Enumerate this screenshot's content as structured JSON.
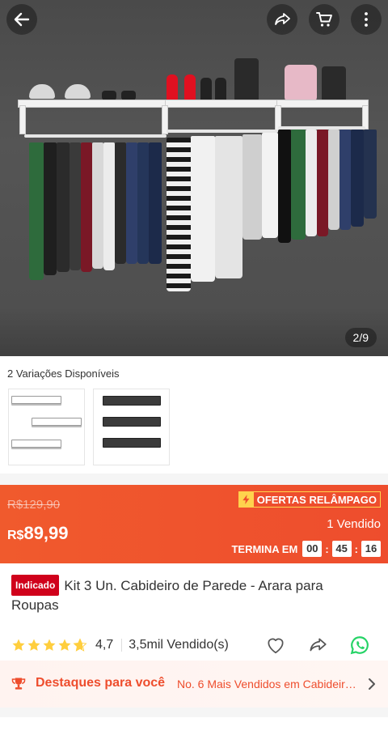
{
  "header": {
    "back_icon": "arrow-left-icon",
    "share_icon": "share-icon",
    "cart_icon": "cart-icon",
    "more_icon": "more-vertical-icon"
  },
  "gallery": {
    "counter": "2/9"
  },
  "variations": {
    "title": "2 Variações Disponíveis",
    "options": [
      {
        "name": "white-shelf-set",
        "color": "#ffffff"
      },
      {
        "name": "black-shelf-set",
        "color": "#333333"
      }
    ]
  },
  "deal": {
    "old_price": "R$129,90",
    "currency": "R$",
    "price": "89,99",
    "flash_label": "OFERTAS RELÂMPAGO",
    "sold": "1 Vendido",
    "ends_label": "TERMINA EM",
    "timer": {
      "h": "00",
      "m": "45",
      "s": "16"
    }
  },
  "product": {
    "badge": "Indicado",
    "title": "Kit 3 Un. Cabideiro de Parede - Arara para Roupas",
    "rating": "4,7",
    "rating_stars": 4.7,
    "sold_total": "3,5mil Vendido(s)"
  },
  "highlights": {
    "title": "Destaques para você",
    "text": "No. 6 Mais Vendidos em Cabideiro ..."
  },
  "colors": {
    "accent": "#ee4d2d",
    "star": "#ffce3d",
    "whatsapp": "#25d366",
    "badge": "#d0011b"
  }
}
